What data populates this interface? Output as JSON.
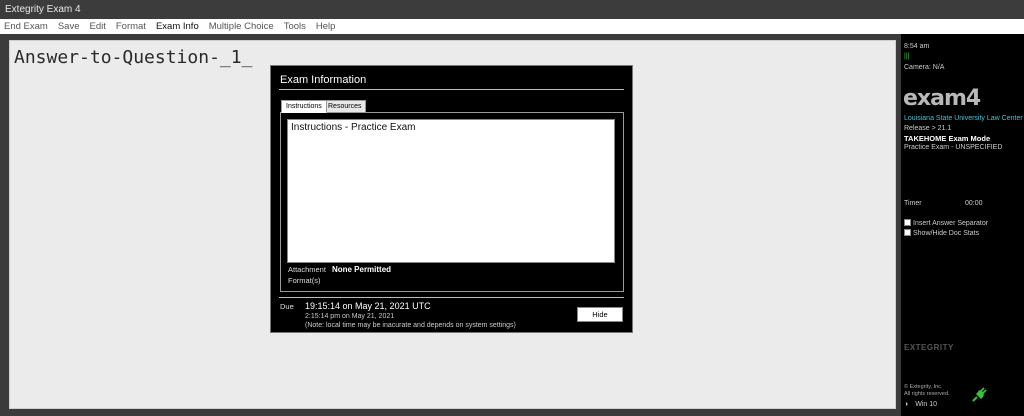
{
  "window": {
    "title": "Extegrity Exam 4"
  },
  "menu": [
    {
      "label": "End Exam",
      "active": false
    },
    {
      "label": "Save",
      "active": false
    },
    {
      "label": "Edit",
      "active": false
    },
    {
      "label": "Format",
      "active": false
    },
    {
      "label": "Exam Info",
      "active": true
    },
    {
      "label": "Multiple Choice",
      "active": false
    },
    {
      "label": "Tools",
      "active": false
    },
    {
      "label": "Help",
      "active": false
    }
  ],
  "editor": {
    "heading": "Answer-to-Question-_1_"
  },
  "dialog": {
    "title": "Exam Information",
    "tabs": [
      "Instructions",
      "Resources"
    ],
    "instructions_text": "Instructions - Practice Exam",
    "attachment_label": "Attachment",
    "attachment_value": "None Permitted",
    "formats_label": "Format(s)",
    "due_label": "Due",
    "due_utc": "19:15:14 on May 21, 2021 UTC",
    "due_local": "2:15:14 pm on May 21, 2021",
    "due_note": "(Note: local time may be inacurate and depends on system settings)",
    "hide_button": "Hide"
  },
  "sidebar": {
    "time": "8:54 am",
    "signal": "|||",
    "camera": "Camera: N/A",
    "logo": "exam4",
    "school": "Louisiana State University Law Center",
    "release": "Release > 21.1",
    "mode": "TAKEHOME Exam Mode",
    "exam_name": "Practice Exam - UNSPECIFIED",
    "timer_label": "Timer",
    "timer_value": "00:00",
    "checkbox_separator": "Insert Answer Separator",
    "checkbox_docstats": "Show/Hide Doc Stats",
    "brand": "EXTEGRITY",
    "copyright_1": "© Extegrity, Inc.",
    "copyright_2": "All rights reserved.",
    "os": "Win 10",
    "colors": {
      "school": "#4ac0d8",
      "plug": "#3cbf3c"
    }
  }
}
